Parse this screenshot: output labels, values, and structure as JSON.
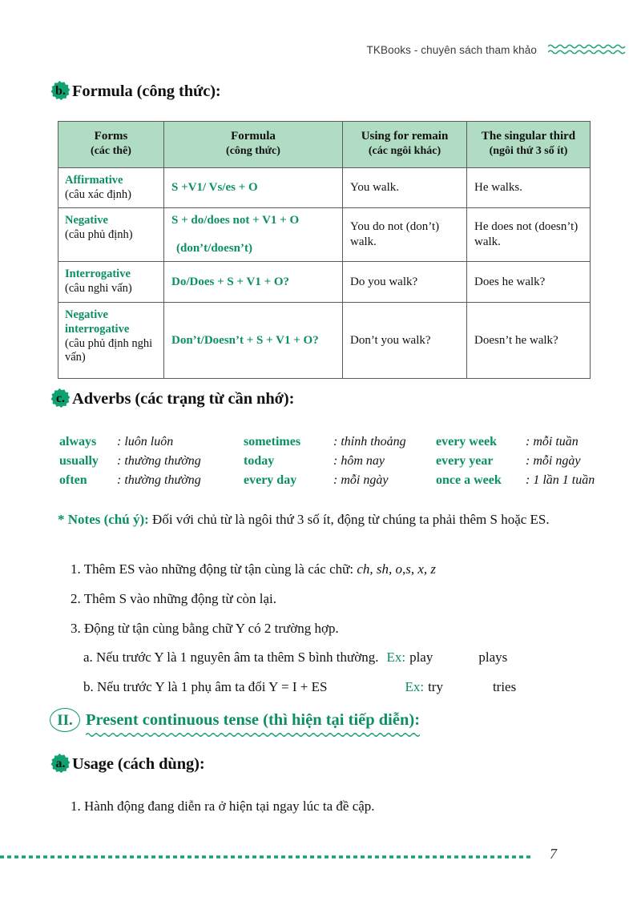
{
  "colors": {
    "brand_green": "#0b8f63",
    "table_header_bg": "#b0dcc3",
    "rule_green": "#15a077",
    "text": "#111111"
  },
  "running_header": {
    "text": "TKBooks - chuyên sách tham khảo",
    "decoration_icon": "wavy-lines-icon"
  },
  "section_b": {
    "badge": "b.",
    "title": "Formula (công thức):"
  },
  "table": {
    "columns": [
      {
        "en": "Forms",
        "vi": "(các thê)"
      },
      {
        "en": "Formula",
        "vi": "(công thức)"
      },
      {
        "en": "Using for remain",
        "vi": "(các ngôi khác)"
      },
      {
        "en": "The singular third",
        "vi": "(ngôi thứ 3 số ít)"
      }
    ],
    "rows": [
      {
        "form_en": "Affirmative",
        "form_vi": "(câu xác định)",
        "formula": "S +V1/ Vs/es + O",
        "formula_sub": "",
        "remain": "You walk.",
        "third": "He walks."
      },
      {
        "form_en": "Negative",
        "form_vi": "(câu phủ định)",
        "formula": "S + do/does not + V1 + O",
        "formula_sub": "(don’t/doesn’t)",
        "remain": "You do not (don’t) walk.",
        "third": "He does not (doesn’t) walk."
      },
      {
        "form_en": "Interrogative",
        "form_vi": "(câu nghi vấn)",
        "formula": "Do/Does + S + V1 + O?",
        "formula_sub": "",
        "remain": "Do you walk?",
        "third": "Does he walk?"
      },
      {
        "form_en": "Negative interrogative",
        "form_vi": "(câu phủ định nghi vấn)",
        "formula": "Don’t/Doesn’t + S + V1 + O?",
        "formula_sub": "",
        "remain": "Don’t you walk?",
        "third": "Doesn’t he walk?"
      }
    ]
  },
  "section_c": {
    "badge": "c.",
    "title": "Adverbs (các trạng từ cần nhớ):",
    "adverbs": [
      {
        "en": "always",
        "vi": ": luôn luôn"
      },
      {
        "en": "sometimes",
        "vi": ": thỉnh thoảng"
      },
      {
        "en": "every week",
        "vi": ": mỗi tuần"
      },
      {
        "en": "usually",
        "vi": ": thường thường"
      },
      {
        "en": "today",
        "vi": ": hôm nay"
      },
      {
        "en": "every year",
        "vi": ": mỗi ngày"
      },
      {
        "en": "often",
        "vi": ": thường thường"
      },
      {
        "en": "every day",
        "vi": ": mỗi ngày"
      },
      {
        "en": "once a week",
        "vi": ": 1 lần 1 tuần"
      }
    ]
  },
  "notes": {
    "label": "* Notes (chú ý):",
    "body": " Đối với chủ từ là ngôi thứ 3 số ít, động từ chúng ta phải thêm S hoặc ES.",
    "items": [
      {
        "text": "1. Thêm ES vào những động từ tận cùng là các chữ: ",
        "italic_tail": "ch, sh, o,s, x, z"
      },
      {
        "text": "2. Thêm S vào những động từ còn lại.",
        "italic_tail": ""
      },
      {
        "text": "3. Động từ tận cùng bằng chữ Y có 2 trường hợp.",
        "italic_tail": ""
      }
    ],
    "sub_items": [
      {
        "text": "a. Nếu trước Y là 1 nguyên âm ta thêm S bình thường.",
        "ex_label": "Ex:",
        "ex_base": "play",
        "ex_result": "plays"
      },
      {
        "text": "b. Nếu trước Y là 1 phụ âm ta đổi Y = I + ES",
        "ex_label": "Ex:",
        "ex_base": "try",
        "ex_result": "tries"
      }
    ]
  },
  "section_II": {
    "numeral": "II.",
    "title": "Present continuous tense (thì hiện tại tiếp diễn):"
  },
  "section_a": {
    "badge": "a.",
    "title": "Usage (cách dùng):",
    "items": [
      "1. Hành động đang diễn ra ở hiện tại ngay lúc ta đề cập."
    ]
  },
  "footer": {
    "page_number": "7"
  }
}
